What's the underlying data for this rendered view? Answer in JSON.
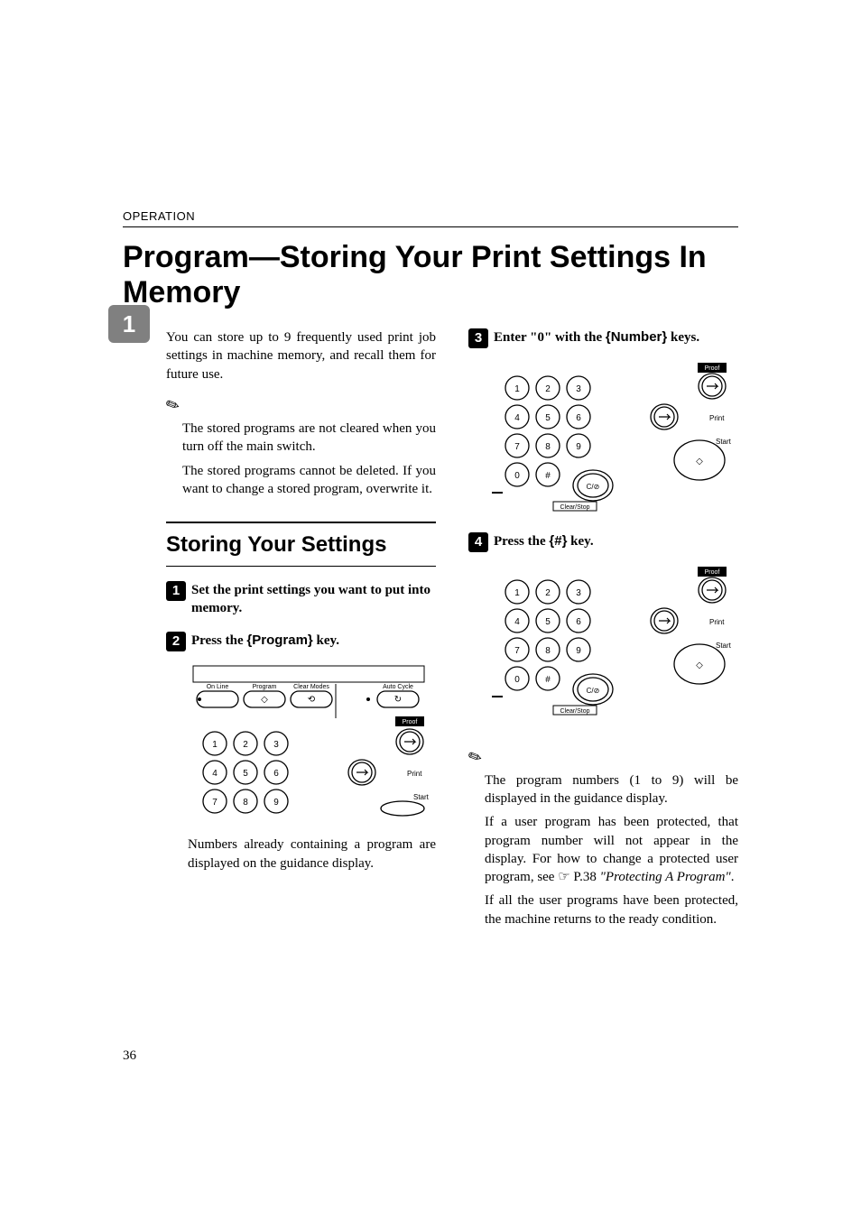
{
  "running_head": "OPERATION",
  "title": "Program—Storing Your Print Settings In Memory",
  "chapter_tab": "1",
  "intro": "You can store up to 9 frequently used print job settings in machine memory, and recall them for future use.",
  "note1_items": [
    "The stored programs are not cleared when you turn off the main switch.",
    "The stored programs cannot be deleted. If you want to change a stored program, overwrite it."
  ],
  "subhead": "Storing Your Settings",
  "steps": {
    "s1": {
      "num": "1",
      "text_pre": "Set the print settings you want to put into memory."
    },
    "s2": {
      "num": "2",
      "text_pre": "Press the ",
      "key": "Program",
      "text_post": " key."
    },
    "s3": {
      "num": "3",
      "text_pre": "Enter \"0\" with the ",
      "key": "Number",
      "text_post": " keys."
    },
    "s4": {
      "num": "4",
      "text_pre": "Press the ",
      "key": "#",
      "text_post": " key."
    }
  },
  "s2_caption": "Numbers already containing a program are displayed on the guidance display.",
  "note2_items": [
    "The program numbers (1 to 9) will be displayed in the guidance display.",
    "If a user program has been protected, that program number will not appear in the display. For how to change a protected user program, see ",
    "If all the user programs have been protected, the machine returns to the ready condition."
  ],
  "note2_ref_text": "\"Protecting A Program\"",
  "note2_ref_page": "P.38 ",
  "page_number": "36",
  "keypad": {
    "topbar": [
      "On Line",
      "Program",
      "Clear Modes",
      "Auto Cycle"
    ],
    "side": {
      "proof": "Proof",
      "print": "Print",
      "start": "Start",
      "clearstop": "Clear/Stop",
      "cstop_short": "C/"
    },
    "digits": [
      "1",
      "2",
      "3",
      "4",
      "5",
      "6",
      "7",
      "8",
      "9",
      "0",
      "#"
    ]
  }
}
